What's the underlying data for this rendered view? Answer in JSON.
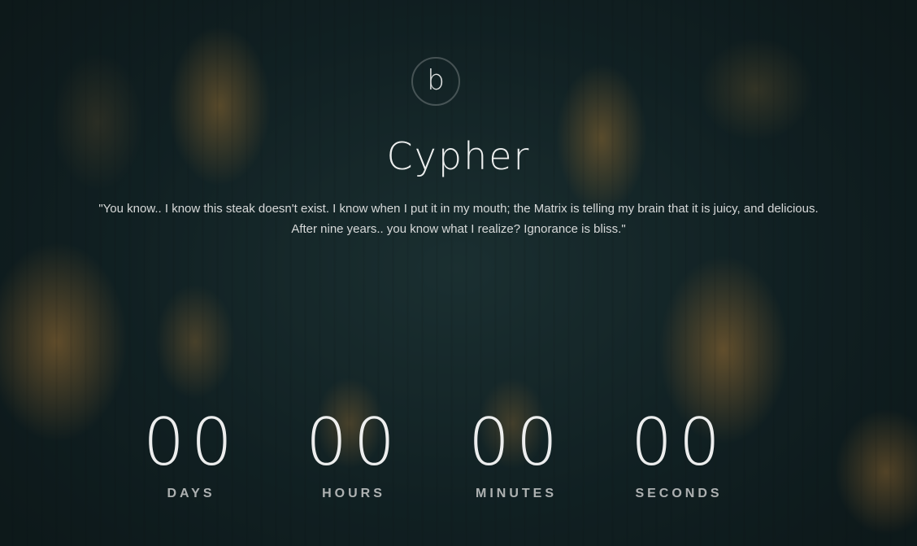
{
  "brand": {
    "logo_letter": "b",
    "title": "Cypher"
  },
  "quote": {
    "line1": "\"You know.. I know this steak doesn't exist. I know when I put it in my mouth; the Matrix is telling my brain that it is juicy, and delicious.",
    "line2": "After nine years.. you know what I realize? Ignorance is bliss.\""
  },
  "countdown": [
    {
      "value": "00",
      "label": "DAYS"
    },
    {
      "value": "00",
      "label": "HOURS"
    },
    {
      "value": "00",
      "label": "MINUTES"
    },
    {
      "value": "00",
      "label": "SECONDS"
    }
  ],
  "colors": {
    "background": "#0f2224",
    "bulb_glow": "#d6963c",
    "text": "#ffffff"
  }
}
